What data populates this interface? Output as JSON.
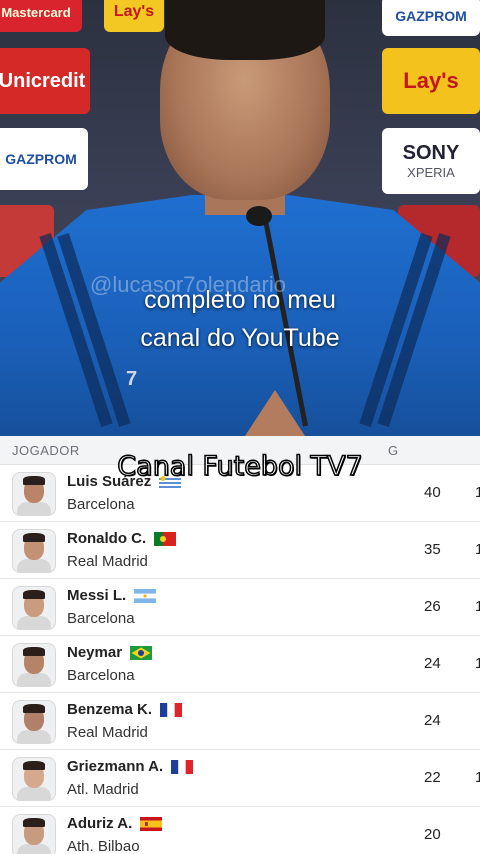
{
  "video": {
    "caption_line1": "completo no meu",
    "caption_line2": "canal do YouTube",
    "watermark": "@lucasor7olendario",
    "sponsors": [
      "Mastercard",
      "Lay's",
      "GAZPROM",
      "Unicredit",
      "SONY",
      "XPERIA"
    ],
    "shirt_badge": "7"
  },
  "overlay_title": "Canal Futebol TV7",
  "table": {
    "header": {
      "player": "JOGADOR",
      "goals": "G"
    },
    "rows": [
      {
        "name": "Luis Suárez",
        "club": "Barcelona",
        "goals": "40",
        "trail": "1",
        "flag": "uruguay-flag",
        "skin": "#b98566"
      },
      {
        "name": "Ronaldo C.",
        "club": "Real Madrid",
        "goals": "35",
        "trail": "1",
        "flag": "portugal-flag",
        "skin": "#c39173"
      },
      {
        "name": "Messi L.",
        "club": "Barcelona",
        "goals": "26",
        "trail": "1",
        "flag": "argentina-flag",
        "skin": "#c99c7e"
      },
      {
        "name": "Neymar",
        "club": "Barcelona",
        "goals": "24",
        "trail": "1",
        "flag": "brazil-flag",
        "skin": "#b58466"
      },
      {
        "name": "Benzema K.",
        "club": "Real Madrid",
        "goals": "24",
        "trail": "",
        "flag": "france-flag",
        "skin": "#b0806a"
      },
      {
        "name": "Griezmann A.",
        "club": "Atl. Madrid",
        "goals": "22",
        "trail": "1",
        "flag": "france-flag",
        "skin": "#d4a98e"
      },
      {
        "name": "Aduriz A.",
        "club": "Ath. Bilbao",
        "goals": "20",
        "trail": "",
        "flag": "spain-flag",
        "skin": "#c79b80"
      }
    ]
  }
}
